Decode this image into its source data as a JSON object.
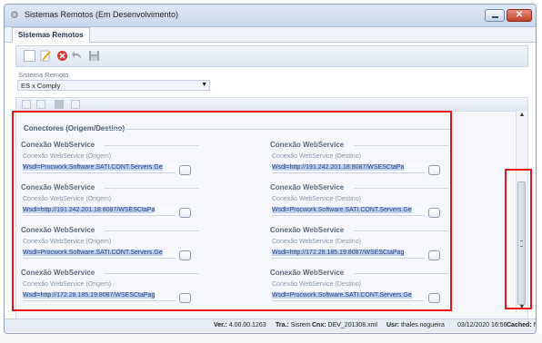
{
  "window": {
    "title": "Sistemas Remotos (Em Desenvolvimento)",
    "icon": "gear-icon",
    "close_glyph": "✕"
  },
  "tabs": [
    {
      "label": "Sistemas Remotos",
      "active": true
    }
  ],
  "toolbar": {
    "items": [
      {
        "name": "new-icon"
      },
      {
        "name": "edit-icon"
      },
      {
        "name": "delete-icon"
      },
      {
        "name": "undo-icon"
      },
      {
        "name": "save-icon"
      }
    ]
  },
  "sistema_remoto": {
    "label": "Sistema Remoto",
    "value": "ES x Comply"
  },
  "group": {
    "title": "Conectores (Origem/Destino)"
  },
  "connectors": [
    {
      "origem": {
        "header": "Conexão WebService",
        "sub": "Conexão WebService (Origem)",
        "value": "Wsdl=Procwork.Software.SATI.CONT.Servers.Ge"
      },
      "destino": {
        "header": "Conexão WebService",
        "sub": "Conexão WebService (Destino)",
        "value": "Wsdl=http://191.242.201.18:8087/WSESCtaPa"
      }
    },
    {
      "origem": {
        "header": "Conexão WebService",
        "sub": "Conexão WebService (Origem)",
        "value": "Wsdl=http://191.242.201.18:8087/WSESCtaPa"
      },
      "destino": {
        "header": "Conexão WebService",
        "sub": "Conexão WebService (Destino)",
        "value": "Wsdl=Procwork.Software.SATI.CONT.Servers.Ge"
      }
    },
    {
      "origem": {
        "header": "Conexão WebService",
        "sub": "Conexão WebService (Origem)",
        "value": "Wsdl=Procwork.Software.SATI.CONT.Servers.Ge"
      },
      "destino": {
        "header": "Conexão WebService",
        "sub": "Conexão WebService (Destino)",
        "value": "Wsdl=http://172.28.185.19:8087/WSESCtaPag"
      }
    },
    {
      "origem": {
        "header": "Conexão WebService",
        "sub": "Conexão WebService (Origem)",
        "value": "Wsdl=http://172.28.185.19:8087/WSESCtaPag"
      },
      "destino": {
        "header": "Conexão WebService",
        "sub": "Conexão WebService (Destino)",
        "value": "Wsdl=Procwork.Software.SATI.CONT.Servers.Ge"
      }
    }
  ],
  "status": {
    "ver_label": "Ver.:",
    "ver_value": "4.00.00.1263",
    "tra_label": "Tra.:",
    "tra_value": "Sisrem",
    "cnx_label": "Cnx:",
    "cnx_value": "DEV_201308.xml",
    "usr_label": "Usr:",
    "usr_value": "thales.nogueira",
    "datetime": "03/12/2020 16:56",
    "cached_label": "Cached:",
    "cached_value": "N"
  },
  "colors": {
    "highlight_box": "#e8161a",
    "field_text": "#1d3f8a"
  }
}
